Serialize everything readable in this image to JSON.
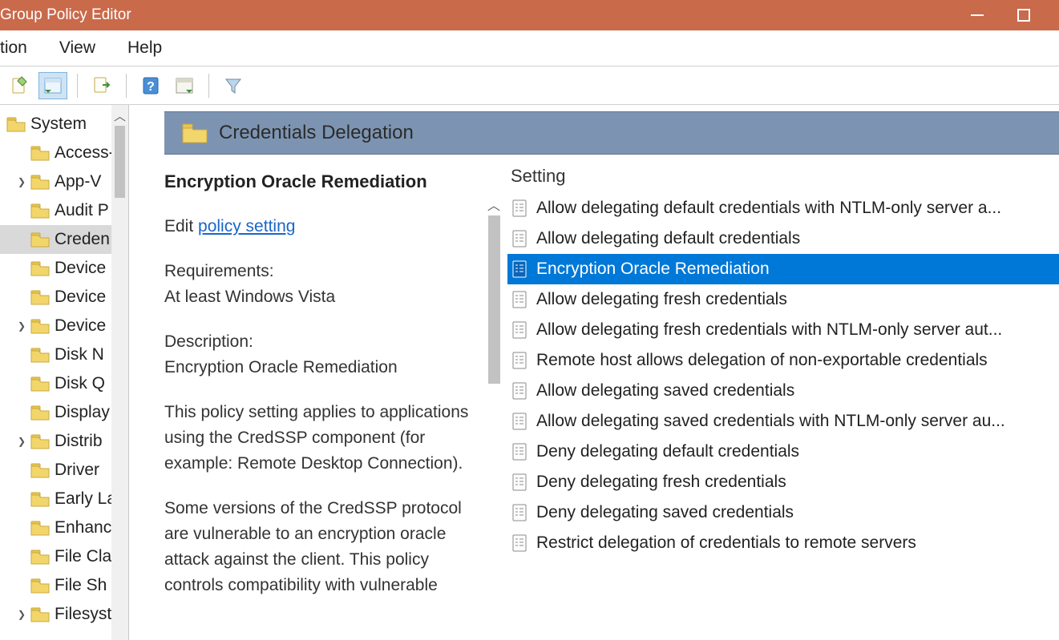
{
  "window": {
    "title": "Group Policy Editor"
  },
  "menu": {
    "items": [
      "tion",
      "View",
      "Help"
    ]
  },
  "toolbar": {
    "icons": [
      "doc-add",
      "list-left",
      "export",
      "help",
      "properties",
      "filter"
    ]
  },
  "tree": {
    "root": {
      "label": "System",
      "expanded": true
    },
    "children": [
      {
        "label": "Access-",
        "expander": ""
      },
      {
        "label": "App-V",
        "expander": ">"
      },
      {
        "label": "Audit P",
        "expander": ""
      },
      {
        "label": "Creden",
        "expander": "",
        "selected": true
      },
      {
        "label": "Device",
        "expander": ""
      },
      {
        "label": "Device",
        "expander": ""
      },
      {
        "label": "Device",
        "expander": ">"
      },
      {
        "label": "Disk N",
        "expander": ""
      },
      {
        "label": "Disk Q",
        "expander": ""
      },
      {
        "label": "Display",
        "expander": ""
      },
      {
        "label": "Distrib",
        "expander": ">"
      },
      {
        "label": "Driver",
        "expander": ""
      },
      {
        "label": "Early La",
        "expander": ""
      },
      {
        "label": "Enhanc",
        "expander": ""
      },
      {
        "label": "File Cla",
        "expander": ""
      },
      {
        "label": "File Sh",
        "expander": ""
      },
      {
        "label": "Filesyst",
        "expander": ">"
      }
    ]
  },
  "content": {
    "header_title": "Credentials Delegation"
  },
  "detail": {
    "setting_name": "Encryption Oracle Remediation",
    "edit_prefix": "Edit ",
    "edit_link": "policy setting",
    "requirements_label": "Requirements:",
    "requirements_value": "At least Windows Vista",
    "description_label": "Description:",
    "description_title": "Encryption Oracle Remediation",
    "para1": "This policy setting applies to applications using the CredSSP component (for example: Remote Desktop Connection).",
    "para2": "Some versions of the CredSSP protocol are vulnerable to an encryption oracle attack against the client.  This policy controls compatibility with vulnerable"
  },
  "settings": {
    "column_header": "Setting",
    "items": [
      {
        "label": "Allow delegating default credentials with NTLM-only server a...",
        "selected": false
      },
      {
        "label": "Allow delegating default credentials",
        "selected": false
      },
      {
        "label": "Encryption Oracle Remediation",
        "selected": true
      },
      {
        "label": "Allow delegating fresh credentials",
        "selected": false
      },
      {
        "label": "Allow delegating fresh credentials with NTLM-only server aut...",
        "selected": false
      },
      {
        "label": "Remote host allows delegation of non-exportable credentials",
        "selected": false
      },
      {
        "label": "Allow delegating saved credentials",
        "selected": false
      },
      {
        "label": "Allow delegating saved credentials with NTLM-only server au...",
        "selected": false
      },
      {
        "label": "Deny delegating default credentials",
        "selected": false
      },
      {
        "label": "Deny delegating fresh credentials",
        "selected": false
      },
      {
        "label": "Deny delegating saved credentials",
        "selected": false
      },
      {
        "label": "Restrict delegation of credentials to remote servers",
        "selected": false
      }
    ]
  }
}
